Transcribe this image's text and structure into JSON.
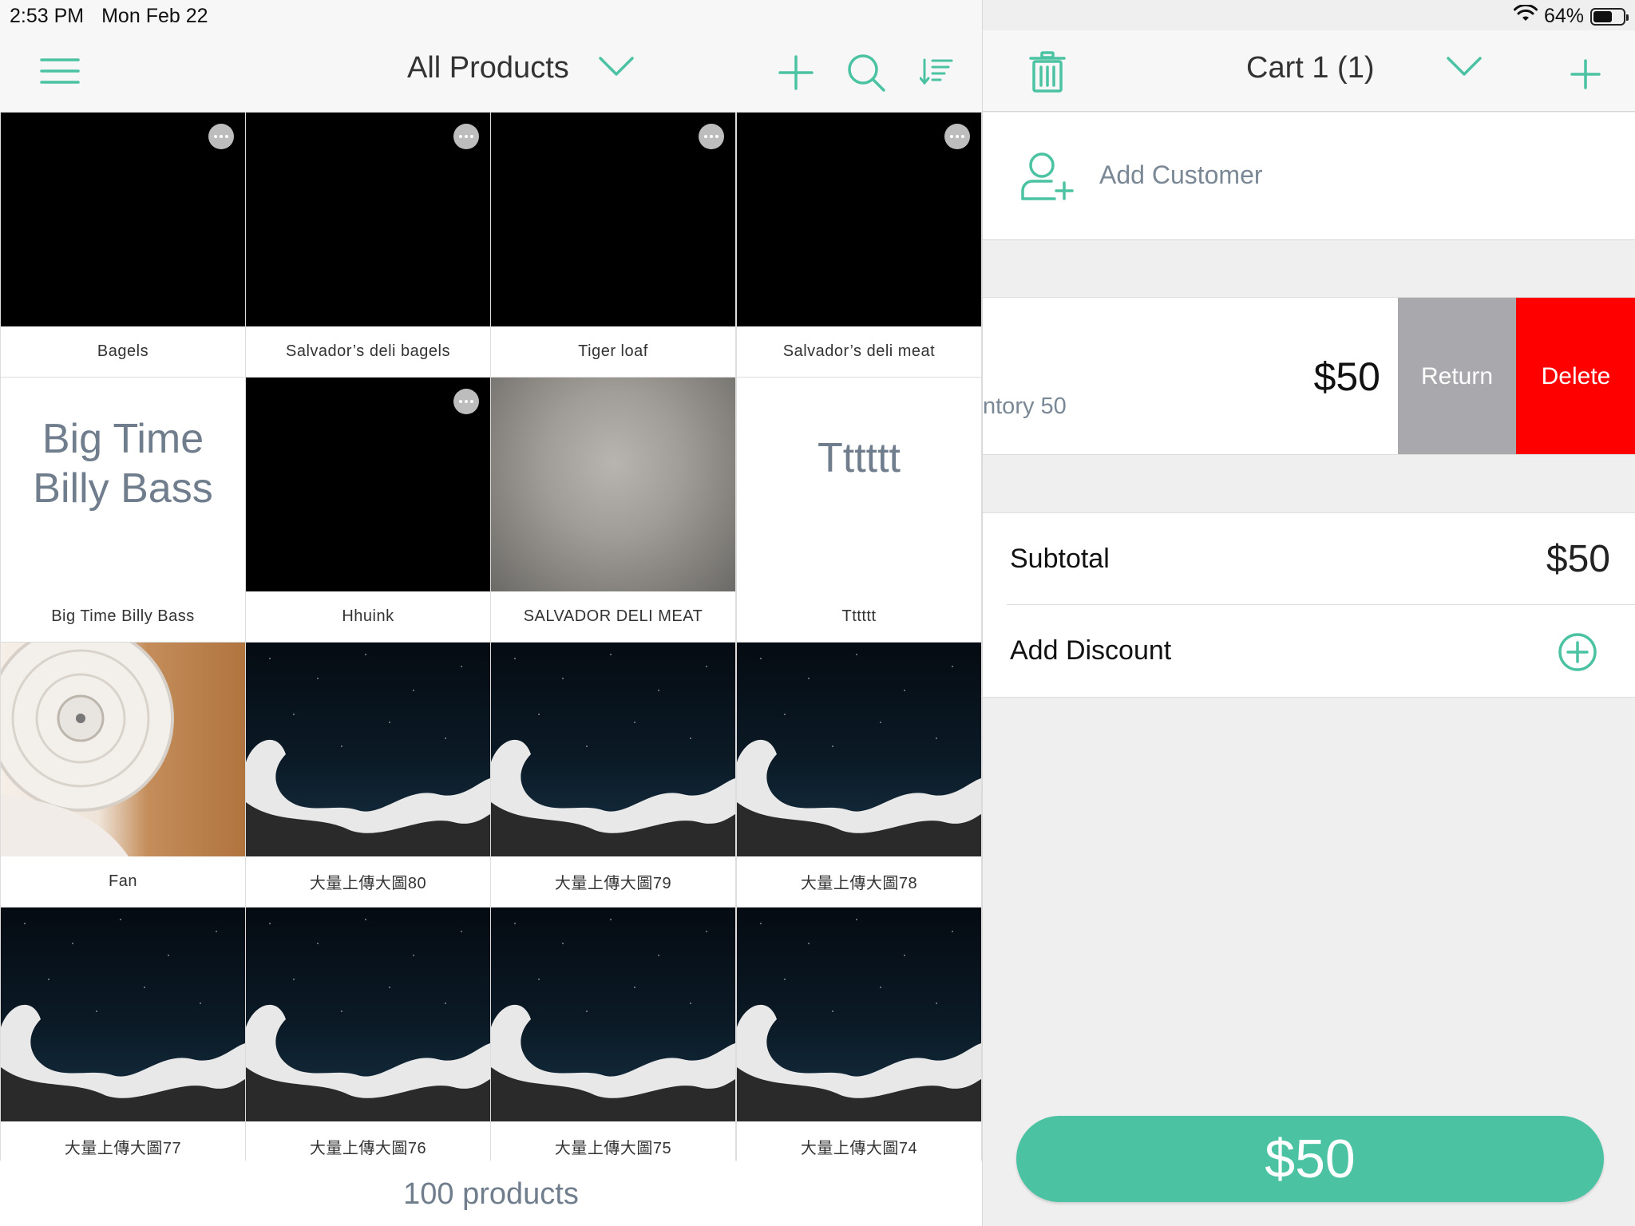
{
  "status_bar": {
    "time": "2:53 PM",
    "date": "Mon Feb 22",
    "battery": "64%",
    "battery_level": 0.64
  },
  "product_panel": {
    "title": "All Products",
    "footer": "100 products",
    "accent_color": "#4bc3a3",
    "tiles": [
      {
        "label": "Bagels",
        "image": "black",
        "more": true
      },
      {
        "label": "Salvador’s deli bagels",
        "image": "black",
        "more": true
      },
      {
        "label": "Tiger loaf",
        "image": "black",
        "more": true
      },
      {
        "label": "Salvador’s deli meat",
        "image": "black",
        "more": true
      },
      {
        "label": "Big Time Billy Bass",
        "image": "text",
        "text": "Big Time Billy Bass",
        "more": false
      },
      {
        "label": "Hhuink",
        "image": "black",
        "more": true
      },
      {
        "label": "SALVADOR DELI MEAT",
        "image": "gray",
        "more": false
      },
      {
        "label": "Tttttt",
        "image": "text",
        "text": "Tttttt",
        "more": false
      },
      {
        "label": "Fan",
        "image": "fan",
        "more": false
      },
      {
        "label": "大量上傳大圖80",
        "image": "wave",
        "more": false
      },
      {
        "label": "大量上傳大圖79",
        "image": "wave",
        "more": false
      },
      {
        "label": "大量上傳大圖78",
        "image": "wave",
        "more": false
      },
      {
        "label": "大量上傳大圖77",
        "image": "wave",
        "more": false
      },
      {
        "label": "大量上傳大圖76",
        "image": "wave",
        "more": false
      },
      {
        "label": "大量上傳大圖75",
        "image": "wave",
        "more": false
      },
      {
        "label": "大量上傳大圖74",
        "image": "wave",
        "more": false
      }
    ]
  },
  "cart_panel": {
    "title": "Cart 1 (1)",
    "add_customer": "Add Customer",
    "item": {
      "sub_text": "ntory 50",
      "price": "$50",
      "return_label": "Return",
      "delete_label": "Delete"
    },
    "subtotal_label": "Subtotal",
    "subtotal_value": "$50",
    "discount_label": "Add Discount",
    "pay_label": "$50",
    "delete_color": "#ff0000",
    "return_color": "#a8a8ad"
  }
}
